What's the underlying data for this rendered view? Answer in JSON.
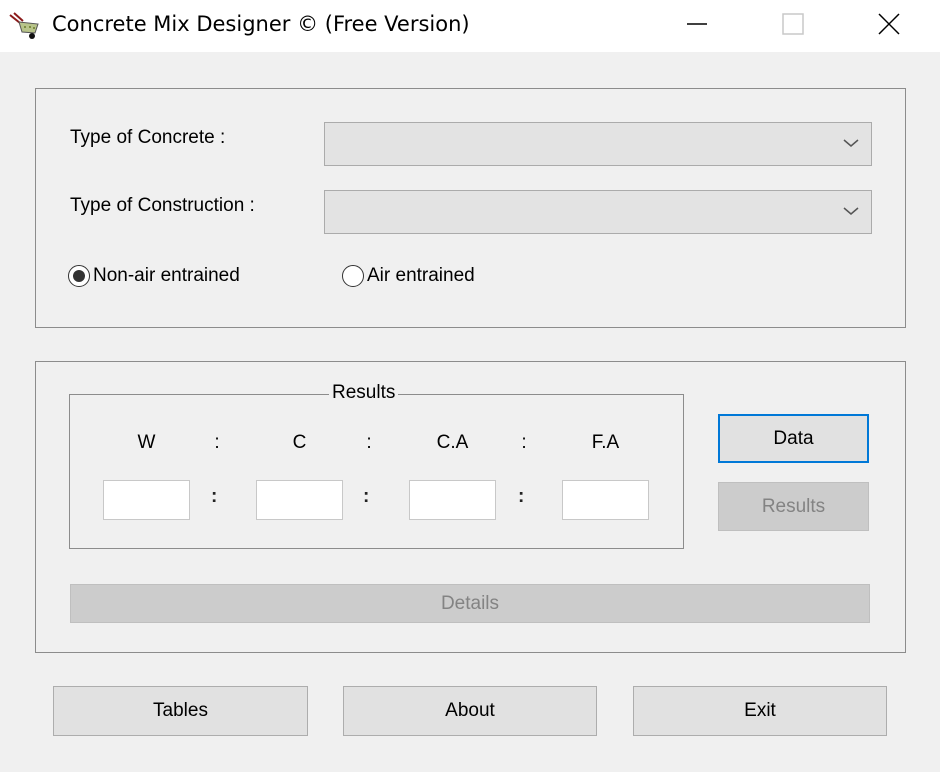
{
  "window": {
    "title": "Concrete Mix Designer © (Free Version)",
    "app_icon": "wheelbarrow-icon",
    "controls": [
      "minimize-icon",
      "maximize-icon",
      "close-icon"
    ]
  },
  "inputs": {
    "concrete_type_label": "Type of Concrete :",
    "concrete_type_value": "",
    "construction_type_label": "Type of Construction :",
    "construction_type_value": "",
    "air_options": [
      {
        "label": "Non-air entrained",
        "selected": true
      },
      {
        "label": "Air entrained",
        "selected": false
      }
    ]
  },
  "results": {
    "legend": "Results",
    "headers": [
      "W",
      "C",
      "C.A",
      "F.A"
    ],
    "separator": ":",
    "values": [
      "",
      "",
      "",
      ""
    ]
  },
  "buttons": {
    "data": "Data",
    "results": "Results",
    "details": "Details",
    "tables": "Tables",
    "about": "About",
    "exit": "Exit"
  }
}
